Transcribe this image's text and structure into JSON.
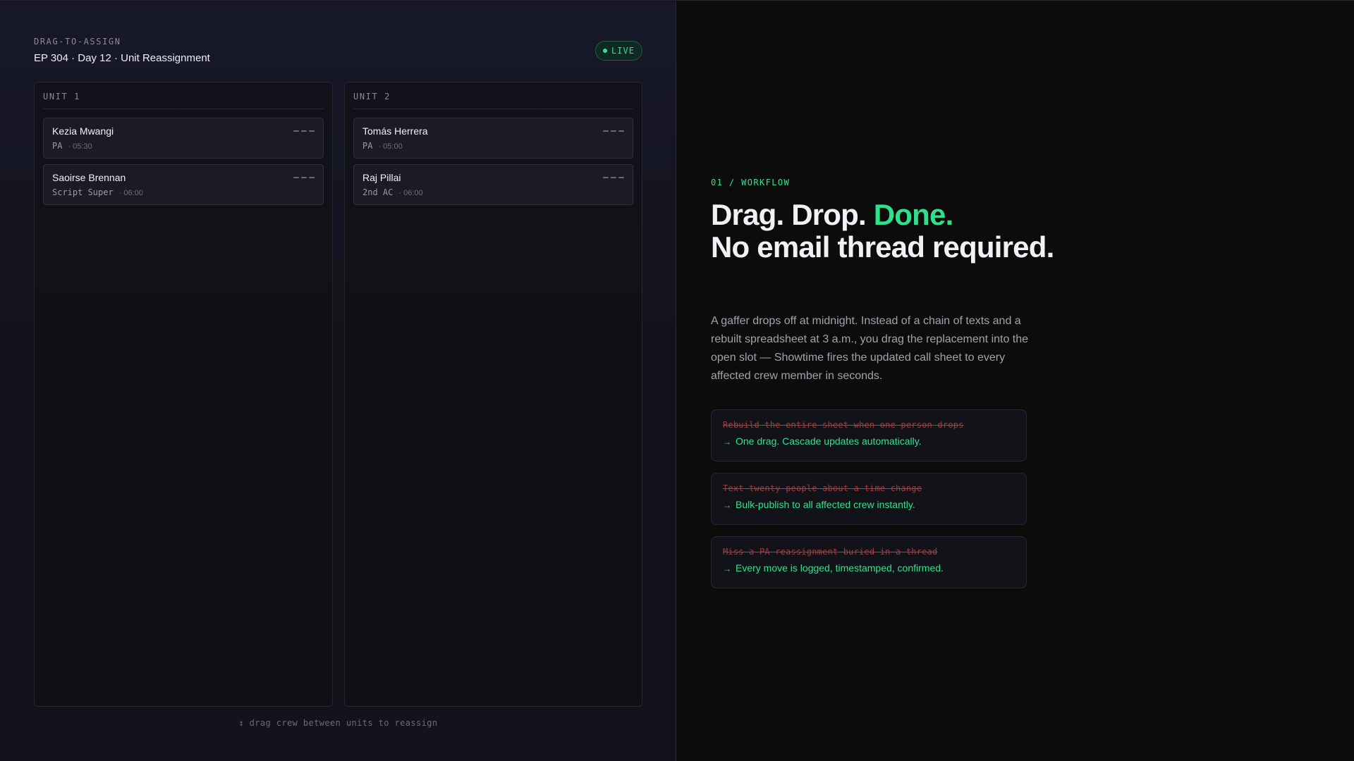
{
  "board": {
    "eyebrow": "DRAG-TO-ASSIGN",
    "title": "EP 304 · Day 12 · Unit Reassignment",
    "status": "LIVE",
    "hint": "↕ drag crew between units to reassign",
    "units": [
      {
        "label": "UNIT 1",
        "crew": [
          {
            "name": "Kezia Mwangi",
            "role": "PA",
            "time": "· 05:30"
          },
          {
            "name": "Saoirse Brennan",
            "role": "Script Super",
            "time": "· 06:00"
          }
        ]
      },
      {
        "label": "UNIT 2",
        "crew": [
          {
            "name": "Tomás Herrera",
            "role": "PA",
            "time": "· 05:00"
          },
          {
            "name": "Raj Pillai",
            "role": "2nd AC",
            "time": "· 06:00"
          }
        ]
      }
    ]
  },
  "feature": {
    "eyebrow": "01 / WORKFLOW",
    "headline_part1": "Drag. Drop. ",
    "headline_accent": "Done.",
    "headline_part2": "No email thread required.",
    "body": "A gaffer drops off at midnight. Instead of a chain of texts and a rebuilt spreadsheet at 3 a.m., you drag the replacement into the open slot — Showtime fires the updated call sheet to every affected crew member in seconds.",
    "comparisons": [
      {
        "old": "Rebuild the entire sheet when one person drops",
        "arrow": "→",
        "new": "One drag. Cascade updates automatically."
      },
      {
        "old": "Text twenty people about a time change",
        "arrow": "→",
        "new": "Bulk-publish to all affected crew instantly."
      },
      {
        "old": "Miss a PA reassignment buried in a thread",
        "arrow": "→",
        "new": "Every move is logged, timestamped, confirmed."
      }
    ]
  },
  "colors": {
    "accent": "#2fe08a",
    "strike": "#a03a3a",
    "panel": "#171829"
  },
  "icons": {
    "grip": "drag-handle-icon",
    "live": "live-dot-icon",
    "arrow": "arrow-right-icon"
  }
}
